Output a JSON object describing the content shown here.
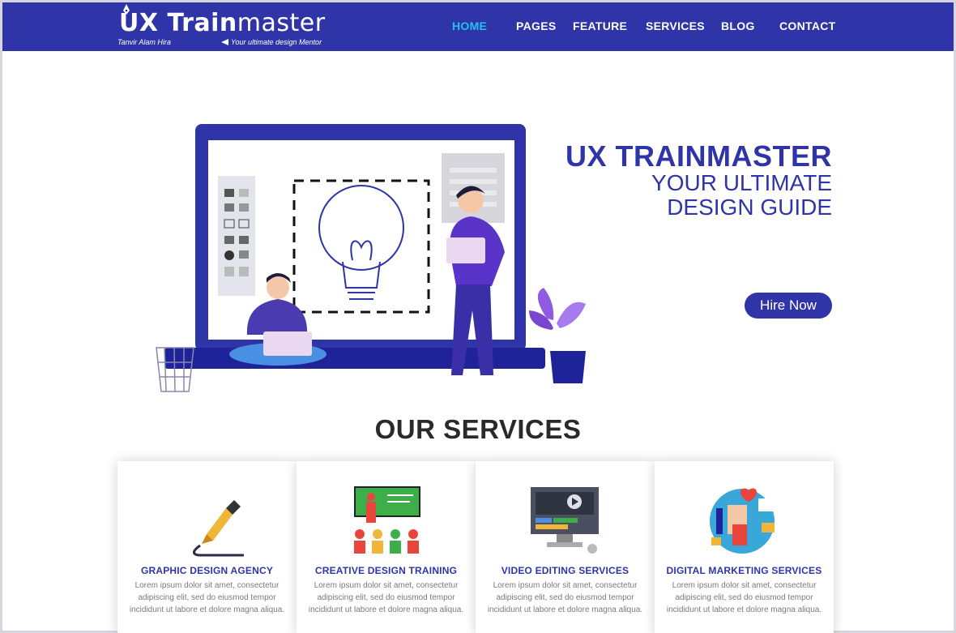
{
  "logo": {
    "ux": "UX",
    "train": " Train",
    "master": "master",
    "author": "Tanvir Alam Hira",
    "tagline": "Your ultimate design Mentor"
  },
  "nav": {
    "items": [
      "HOME",
      "PAGES",
      "FEATURE",
      "SERVICES",
      "BLOG",
      "CONTACT"
    ],
    "active": "HOME"
  },
  "hero": {
    "title": "UX TRAINMASTER",
    "subtitle": "YOUR ULTIMATE\nDESIGN GUIDE",
    "cta": "Hire Now"
  },
  "services": {
    "heading": "OUR SERVICES",
    "items": [
      {
        "title": "GRAPHIC DESIGN AGENCY",
        "text": "Lorem ipsum dolor sit amet, consectetur adipiscing elit, sed do eiusmod tempor incididunt ut labore et dolore magna aliqua.",
        "icon": "pen-nib-icon"
      },
      {
        "title": "CREATIVE DESIGN TRAINING",
        "text": "Lorem ipsum dolor sit amet, consectetur adipiscing elit, sed do eiusmod tempor incididunt ut labore et dolore magna aliqua.",
        "icon": "presentation-board-icon"
      },
      {
        "title": "VIDEO EDITING SERVICES",
        "text": "Lorem ipsum dolor sit amet, consectetur adipiscing elit, sed do eiusmod tempor incididunt ut labore et dolore magna aliqua.",
        "icon": "video-editor-monitor-icon"
      },
      {
        "title": "DIGITAL MARKETING SERVICES",
        "text": "Lorem ipsum dolor sit amet, consectetur adipiscing elit, sed do eiusmod tempor incididunt ut labore et dolore magna aliqua.",
        "icon": "social-media-like-icon"
      }
    ]
  },
  "colors": {
    "brand": "#2f35a8",
    "nav_active": "#21c2f0",
    "heading": "#2a2a2a",
    "body_text": "#7a7a80"
  }
}
